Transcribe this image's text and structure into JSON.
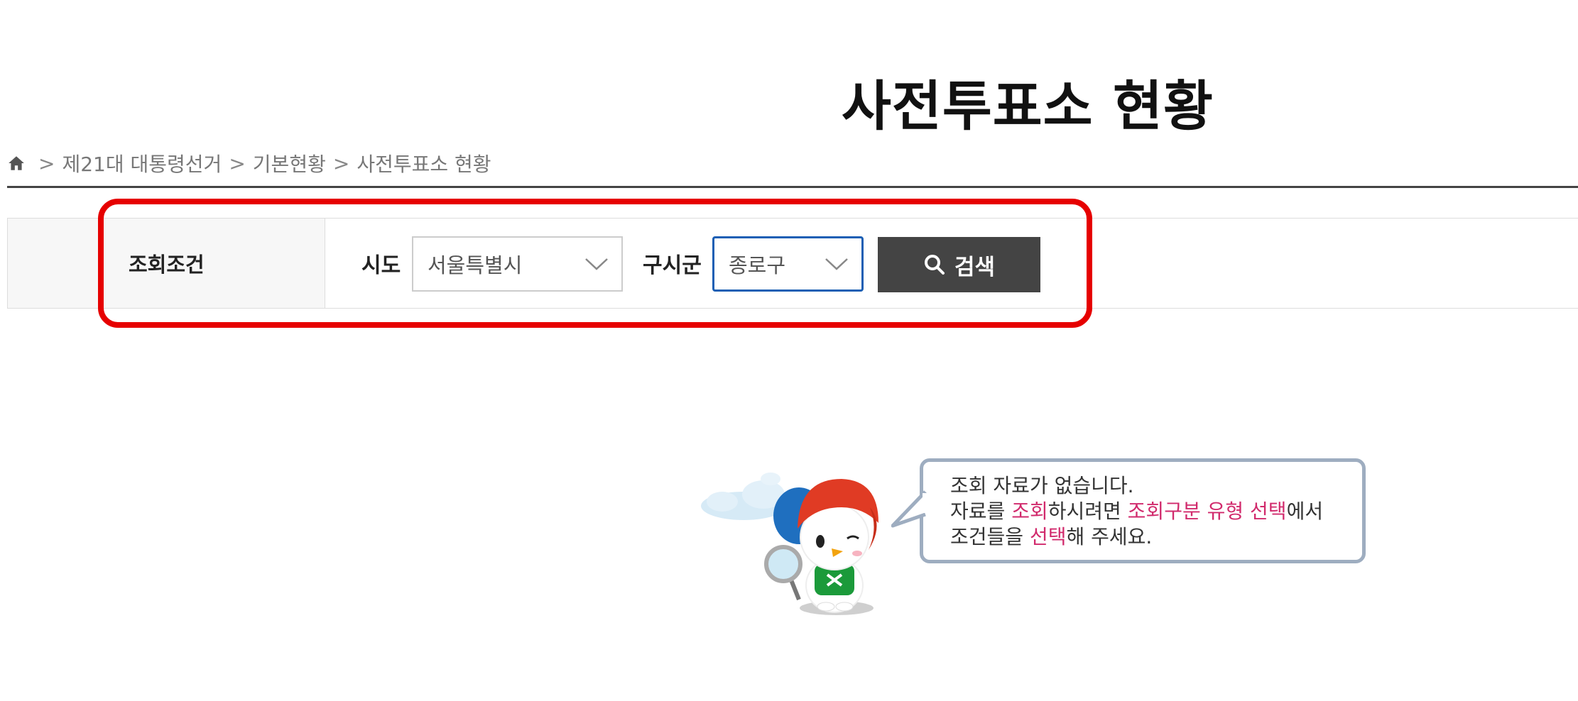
{
  "page": {
    "title": "사전투표소 현황"
  },
  "breadcrumb": {
    "home_icon": "home-icon",
    "items": [
      "제21대 대통령선거",
      "기본현황",
      "사전투표소 현황"
    ],
    "separator": ">"
  },
  "search": {
    "condition_label": "조회조건",
    "sido_label": "시도",
    "sido_value": "서울특별시",
    "gusigun_label": "구시군",
    "gusigun_value": "종로구",
    "button_label": "검색",
    "button_icon": "search-icon"
  },
  "empty_state": {
    "line1": "조회 자료가 없습니다.",
    "line2_part1": "자료를 ",
    "line2_hl1": "조회",
    "line2_part2": "하시려면 ",
    "line2_hl2": "조회구분 유형 선택",
    "line2_part3": "에서",
    "line3_part1": "조건들을 ",
    "line3_hl1": "선택",
    "line3_part2": "해 주세요."
  },
  "colors": {
    "highlight_outline": "#e60000",
    "button_bg": "#444444",
    "focus_border": "#1a5fb4",
    "accent_text": "#d12a6c",
    "bubble_border": "#9eadc0"
  }
}
